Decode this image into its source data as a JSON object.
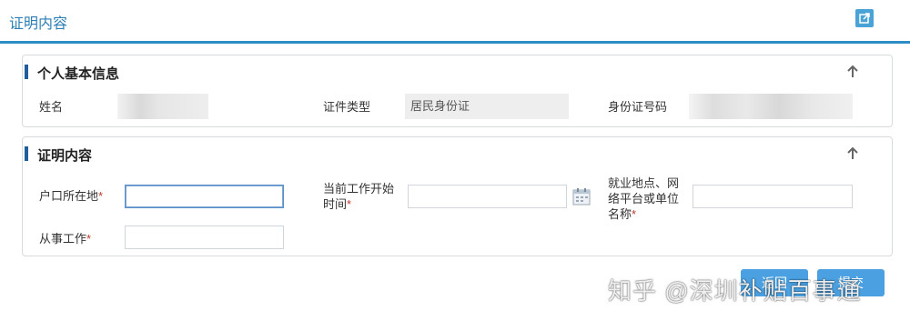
{
  "page": {
    "title": "证明内容"
  },
  "basic_info": {
    "heading": "个人基本信息",
    "name_label": "姓名",
    "name_value": "",
    "id_type_label": "证件类型",
    "id_type_value": "居民身份证",
    "id_number_label": "身份证号码",
    "id_number_value": ""
  },
  "certificate": {
    "heading": "证明内容",
    "hukou_label": "户口所在地",
    "start_time_label_line1": "当前工作开始",
    "start_time_label_line2": "时间",
    "workplace_label_line1": "就业地点、网",
    "workplace_label_line2": "络平台或单位",
    "workplace_label_line3": "名称",
    "job_label": "从事工作",
    "required_mark": "*",
    "hukou_value": "",
    "start_time_value": "",
    "workplace_value": "",
    "job_value": ""
  },
  "actions": {
    "back_label": "返回",
    "submit_label": "提交"
  },
  "watermark": {
    "text": "知乎 @深圳补贴百事通"
  },
  "colors": {
    "accent": "#2d8cc4",
    "heading_bar": "#1f5d9c",
    "button": "#4aa0e0",
    "required": "#c0392b"
  },
  "icons": {
    "export": "export-icon",
    "collapse": "arrow-up-icon",
    "calendar": "calendar-icon"
  }
}
